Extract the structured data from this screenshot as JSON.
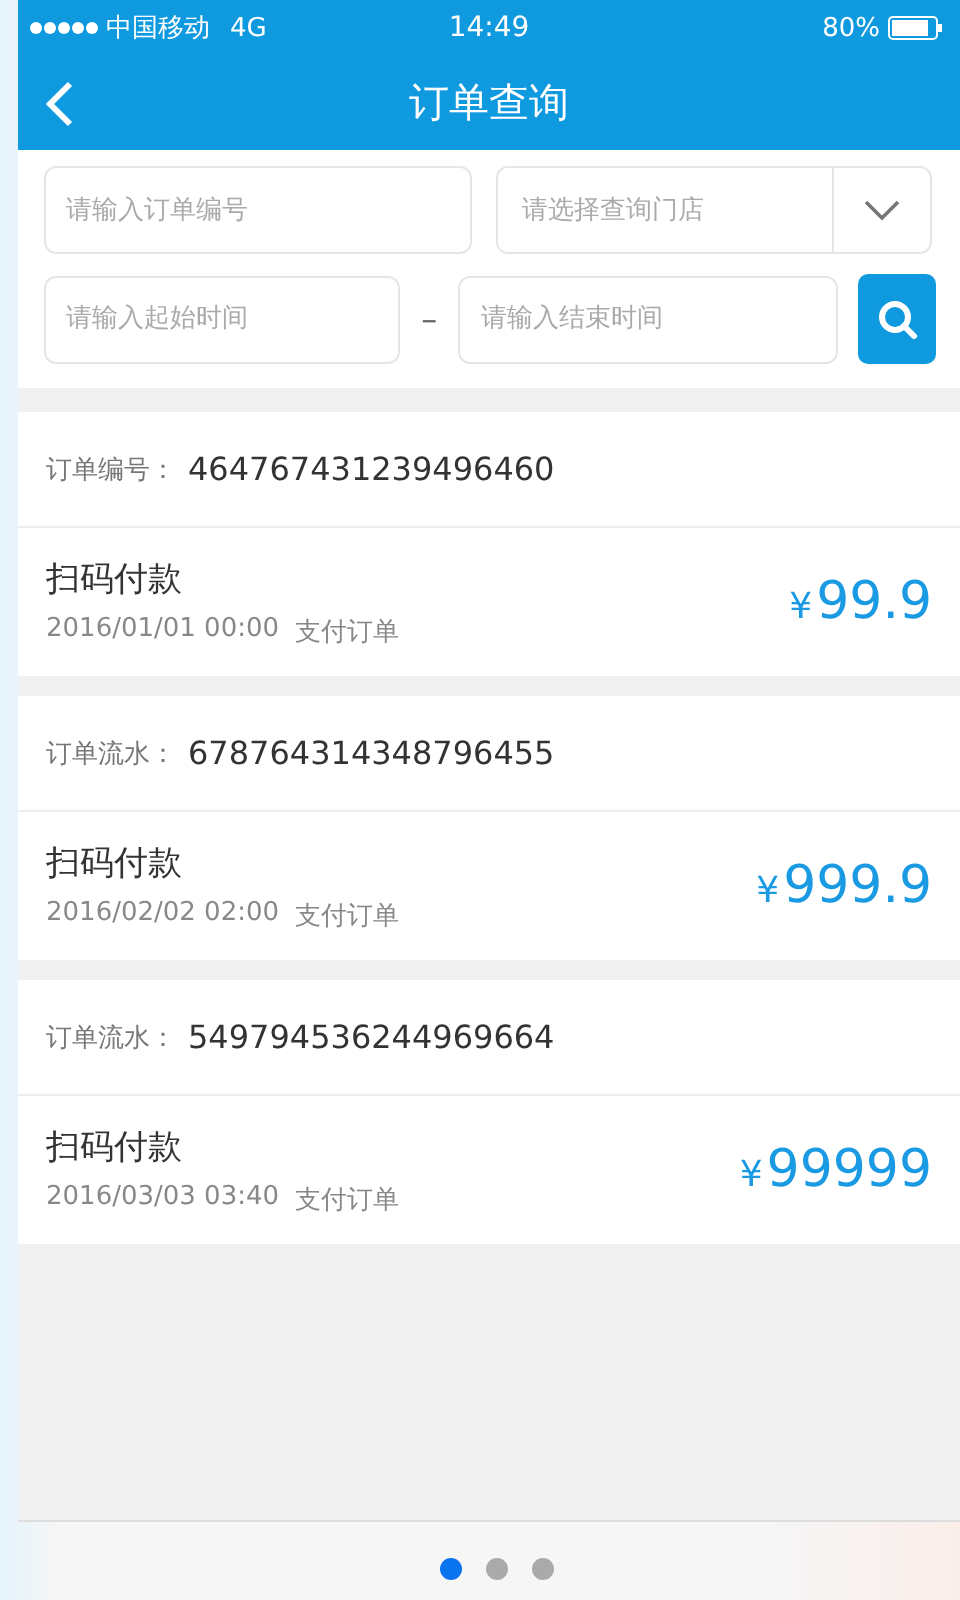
{
  "status_bar": {
    "carrier": "中国移动",
    "network": "4G",
    "time": "14:49",
    "battery": "80%"
  },
  "nav": {
    "title": "订单查询"
  },
  "search": {
    "order_no": {
      "placeholder": "请输入订单编号"
    },
    "store": {
      "placeholder": "请选择查询门店"
    },
    "start": {
      "placeholder": "请输入起始时间"
    },
    "separator": "–",
    "end": {
      "placeholder": "请输入结束时间"
    }
  },
  "orders": [
    {
      "label": "订单编号：",
      "number": "464767431239496460",
      "type": "扫码付款",
      "time": "2016/01/01 00:00",
      "status": "支付订单",
      "currency": "¥",
      "amount": "99.9"
    },
    {
      "label": "订单流水：",
      "number": "678764314348796455",
      "type": "扫码付款",
      "time": "2016/02/02 02:00",
      "status": "支付订单",
      "currency": "¥",
      "amount": "999.9"
    },
    {
      "label": "订单流水：",
      "number": "549794536244969664",
      "type": "扫码付款",
      "time": "2016/03/03 03:40",
      "status": "支付订单",
      "currency": "¥",
      "amount": "99999"
    }
  ],
  "pager": [
    {
      "selected": true
    },
    {
      "selected": false
    },
    {
      "selected": false
    }
  ]
}
